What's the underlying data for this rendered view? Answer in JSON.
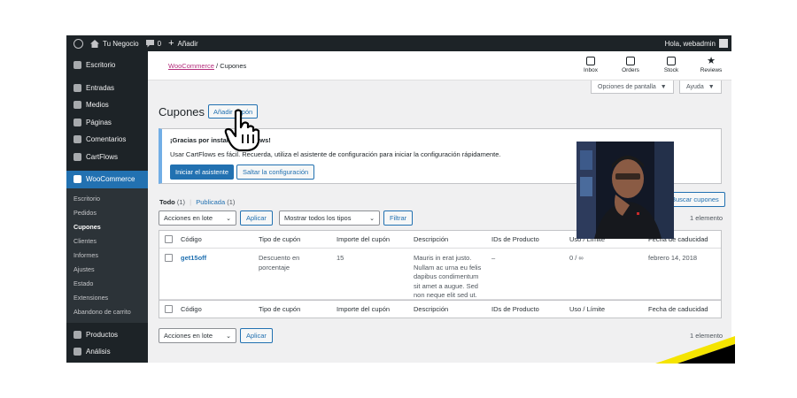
{
  "admin_bar": {
    "site_name": "Tu Negocio",
    "comments_count": "0",
    "new_label": "Añadir",
    "greeting": "Hola, webadmin"
  },
  "sidebar": {
    "items_top": [
      {
        "label": "Escritorio",
        "icon": "dashboard-icon"
      },
      {
        "label": "Entradas",
        "icon": "pin-icon"
      },
      {
        "label": "Medios",
        "icon": "media-icon"
      },
      {
        "label": "Páginas",
        "icon": "page-icon"
      },
      {
        "label": "Comentarios",
        "icon": "comment-icon"
      },
      {
        "label": "CartFlows",
        "icon": "cartflows-icon"
      }
    ],
    "active_item": {
      "label": "WooCommerce",
      "icon": "woo-icon"
    },
    "submenu": [
      "Escritorio",
      "Pedidos",
      "Cupones",
      "Clientes",
      "Informes",
      "Ajustes",
      "Estado",
      "Extensiones",
      "Abandono de carrito"
    ],
    "submenu_current": "Cupones",
    "items_bottom": [
      {
        "label": "Productos",
        "icon": "box-icon"
      },
      {
        "label": "Análisis",
        "icon": "chart-icon"
      }
    ]
  },
  "header": {
    "breadcrumb_link": "WooCommerce",
    "breadcrumb_sep": " / ",
    "breadcrumb_current": "Cupones",
    "buttons": [
      {
        "label": "Inbox",
        "icon": "inbox-icon"
      },
      {
        "label": "Orders",
        "icon": "orders-icon"
      },
      {
        "label": "Stock",
        "icon": "stock-icon"
      },
      {
        "label": "Reviews",
        "icon": "star-icon"
      }
    ]
  },
  "screen_options": {
    "label": "Opciones de pantalla",
    "help": "Ayuda"
  },
  "page": {
    "title": "Cupones",
    "add_button": "Añadir cupón"
  },
  "notice": {
    "title": "¡Gracias por instalar CartFlows!",
    "text": "Usar CartFlows es fácil. Recuerda, utiliza el asistente de configuración para iniciar la configuración rápidamente.",
    "primary_button": "Iniciar el asistente",
    "secondary_button": "Saltar la configuración"
  },
  "views": {
    "all": "Todo",
    "all_count": "(1)",
    "sep": "|",
    "published": "Publicada",
    "published_count": "(1)"
  },
  "search_button": "Buscar cupones",
  "filters": {
    "bulk_actions": "Acciones en lote",
    "apply": "Aplicar",
    "type_filter": "Mostrar todos los tipos",
    "filter_button": "Filtrar",
    "item_count": "1 elemento"
  },
  "table": {
    "columns": [
      "Código",
      "Tipo de cupón",
      "Importe del cupón",
      "Descripción",
      "IDs de Producto",
      "Uso / Límite",
      "Fecha de caducidad"
    ],
    "rows": [
      {
        "code": "get15off",
        "type_line1": "Descuento en",
        "type_line2": "porcentaje",
        "amount": "15",
        "desc_line1": "Mauris in erat justo.",
        "desc_line2": "Nullam ac urna eu felis",
        "desc_line3": "dapibus condimentum",
        "desc_line4": "sit amet a augue. Sed",
        "desc_line5": "non neque elit sed ut.",
        "product_ids": "–",
        "usage": "0 / ∞",
        "expiry": "febrero 14, 2018"
      }
    ]
  },
  "colors": {
    "admin_dark": "#1d2327",
    "primary_blue": "#2271b1",
    "woo_link": "#b32d7b",
    "stripe_yellow": "#f5e400"
  }
}
